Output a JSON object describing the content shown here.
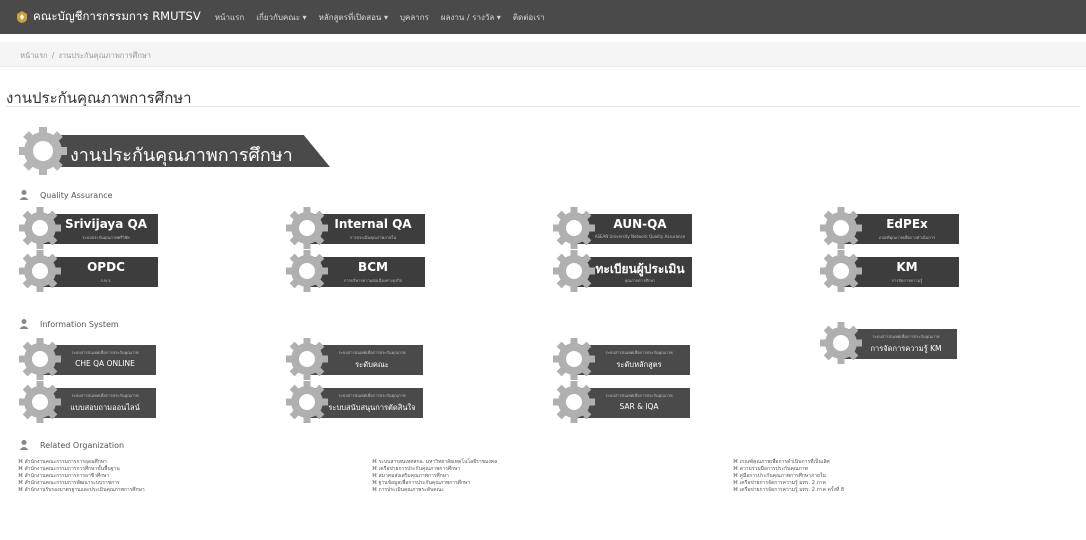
{
  "navbar": {
    "brand": "คณะบัญชีการกรรมการ RMUTSV",
    "items": [
      "หน้าแรก",
      "เกี่ยวกับคณะ ▾",
      "หลักสูตรที่เปิดสอน ▾",
      "บุคลากร",
      "ผลงาน / รางวัล ▾",
      "ติดต่อเรา"
    ]
  },
  "breadcrumb": {
    "home": "หน้าแรก",
    "separator": "/",
    "current": "งานประกันคุณภาพการศึกษา"
  },
  "page_title": "งานประกันคุณภาพการศึกษา",
  "banner_text": "งานประกันคุณภาพการศึกษา",
  "sections": {
    "qa": "Quality Assurance",
    "info": "Information System",
    "org": "Related Organization"
  },
  "qa_tiles": [
    {
      "label": "Srivijaya QA",
      "sub": "ระบบประกันคุณภาพศรีวิชัย"
    },
    {
      "label": "Internal QA",
      "sub": "การประเมินคุณภาพภายใน"
    },
    {
      "label": "AUN-QA",
      "sub": "ASEAN University Network Quality Assurance"
    },
    {
      "label": "EdPEx",
      "sub": "เกณฑ์คุณภาพเพื่อการดำเนินการ"
    },
    {
      "label": "OPDC",
      "sub": "ก.พ.ร."
    },
    {
      "label": "BCM",
      "sub": "การบริหารความต่อเนื่องทางธุรกิจ"
    },
    {
      "label": "ทะเบียนผู้ประเมิน",
      "sub": "คุณภาพการศึกษา"
    },
    {
      "label": "KM",
      "sub": "การจัดการความรู้"
    }
  ],
  "info_tiles": [
    {
      "label": "CHE QA ONLINE",
      "sub": "ระบบสารสนเทศเพื่อการประกันคุณภาพ"
    },
    {
      "label": "ระดับคณะ",
      "sub": "ระบบสารสนเทศเพื่อการประกันคุณภาพ"
    },
    {
      "label": "ระดับหลักสูตร",
      "sub": "ระบบสารสนเทศเพื่อการประกันคุณภาพ"
    },
    {
      "label": "การจัดการความรู้ KM",
      "sub": "ระบบสารสนเทศเพื่อการประกันคุณภาพ"
    },
    {
      "label": "แบบสอบถามออนไลน์",
      "sub": "ระบบสารสนเทศเพื่อการประกันคุณภาพ"
    },
    {
      "label": "ระบบสนับสนุนการตัดสินใจ",
      "sub": "ระบบสารสนเทศเพื่อการประกันคุณภาพ"
    },
    {
      "label": "SAR & IQA",
      "sub": "ระบบสารสนเทศเพื่อการประกันคุณภาพ"
    }
  ],
  "org_links": [
    [
      "สำนักงานคณะกรรมการการอุดมศึกษา",
      "สำนักงานคณะกรรมการการศึกษาขั้นพื้นฐาน",
      "สำนักงานคณะกรรมการการอาชีวศึกษา",
      "สำนักงานคณะกรรมการพัฒนาระบบราชการ",
      "สำนักงานรับรองมาตรฐานและประเมินคุณภาพการศึกษา"
    ],
    [
      "ระบบสารสนเทศสกอ. มหาวิทยาลัยเทคโนโลยีราชมงคล",
      "เครือข่ายการประกันคุณภาพการศึกษา",
      "สมาคมส่งเสริมคุณภาพการศึกษา",
      "ฐานข้อมูลเพื่อการประกันคุณภาพการศึกษา",
      "การประเมินคุณภาพระดับคณะ"
    ],
    [
      "เกณฑ์คุณภาพเพื่อการดำเนินการที่เป็นเลิศ",
      "ความร่วมมือการประกันคุณภาพ",
      "คู่มือการประกันคุณภาพการศึกษาภายใน",
      "เครือข่ายการจัดการความรู้ มทร. 2 ภาค",
      "เครือข่ายการจัดการความรู้ มทร. 2 ภาค ครั้งที่ 8"
    ]
  ]
}
